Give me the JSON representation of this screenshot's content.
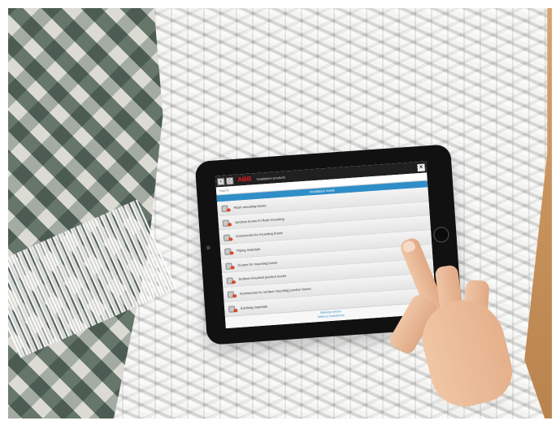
{
  "scene": {
    "brand": "ABB",
    "app_title": "Installation products",
    "search_placeholder": "Search",
    "subheader": "Installation Guide",
    "items": [
      "Flush mounting boxes",
      "Junction boxes for flush mounting",
      "Accessories for mounting boxes",
      "Piping materials",
      "Covers for mounting boxes",
      "Surface mounted junction boxes",
      "Accessories for surface mounting junction boxes",
      "Earthing materials"
    ],
    "footer": {
      "line1": "Working version",
      "line2": "Tablet & Smartphone"
    }
  }
}
